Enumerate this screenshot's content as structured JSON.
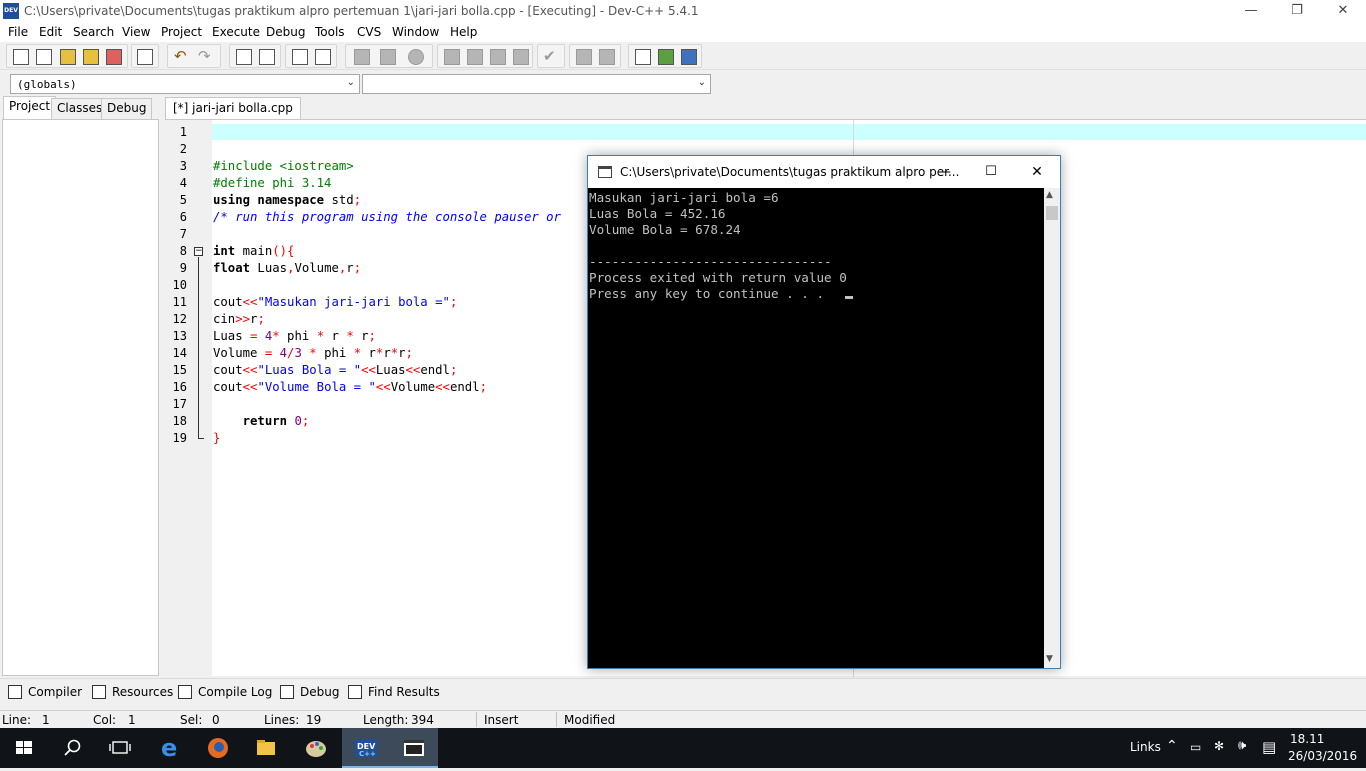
{
  "window": {
    "title": "C:\\Users\\private\\Documents\\tugas praktikum alpro pertemuan 1\\jari-jari bolla.cpp - [Executing] - Dev-C++ 5.4.1",
    "controls": [
      "—",
      "❐",
      "✕"
    ],
    "app_icon_text": "DEV"
  },
  "menu": [
    "File",
    "Edit",
    "Search",
    "View",
    "Project",
    "Execute",
    "Debug",
    "Tools",
    "CVS",
    "Window",
    "Help"
  ],
  "combos": {
    "scope": "(globals)",
    "member": ""
  },
  "left_tabs": [
    "Project",
    "Classes",
    "Debug"
  ],
  "editor": {
    "tab_label": "[*] jari-jari bolla.cpp",
    "line_numbers": [
      "1",
      "2",
      "3",
      "4",
      "5",
      "6",
      "7",
      "8",
      "9",
      "10",
      "11",
      "12",
      "13",
      "14",
      "15",
      "16",
      "17",
      "18",
      "19"
    ],
    "highlight_color": "#ccffff"
  },
  "console": {
    "title": "C:\\Users\\private\\Documents\\tugas praktikum alpro per...",
    "lines": [
      "Masukan jari-jari bola =6",
      "Luas Bola = 452.16",
      "Volume Bola = 678.24",
      "",
      "--------------------------------",
      "Process exited with return value 0",
      "Press any key to continue . . ."
    ]
  },
  "bottom_tabs": [
    "Compiler",
    "Resources",
    "Compile Log",
    "Debug",
    "Find Results"
  ],
  "status": {
    "line_label": "Line:",
    "line_value": "1",
    "col_label": "Col:",
    "col_value": "1",
    "sel_label": "Sel:",
    "sel_value": "0",
    "lines_label": "Lines:",
    "lines_value": "19",
    "length_label": "Length:",
    "length_value": "394",
    "mode": "Insert",
    "state": "Modified"
  },
  "taskbar": {
    "links": "Links",
    "time": "18.11",
    "date": "26/03/2016"
  }
}
